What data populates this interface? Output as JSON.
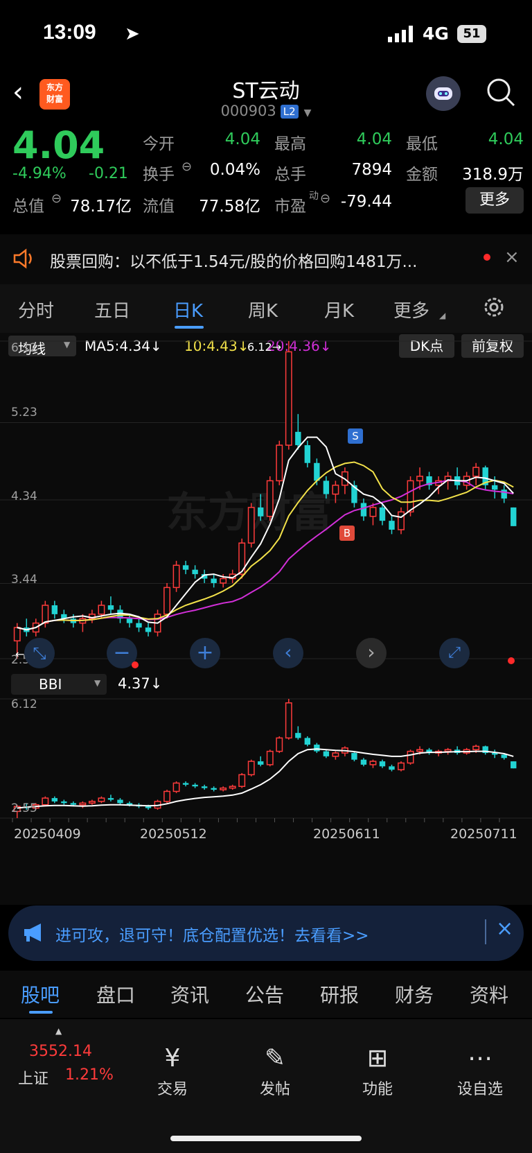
{
  "status": {
    "time": "13:09",
    "network": "4G",
    "battery": "51"
  },
  "header": {
    "logo_text_1": "东方",
    "logo_text_2": "财富",
    "title": "ST云动",
    "code": "000903",
    "badge": "L2"
  },
  "quote": {
    "price": "4.04",
    "change_pct": "-4.94%",
    "change": "-0.21",
    "rows": [
      [
        {
          "l": "今开",
          "v": "4.04",
          "c": "green"
        },
        {
          "l": "最高",
          "v": "4.04",
          "c": "green"
        },
        {
          "l": "最低",
          "v": "4.04",
          "c": "green"
        }
      ],
      [
        {
          "l": "换手",
          "v": "0.04%",
          "c": "white"
        },
        {
          "l": "总手",
          "v": "7894",
          "c": "white"
        },
        {
          "l": "金额",
          "v": "318.9万",
          "c": "white"
        }
      ]
    ],
    "total_value_label": "总值",
    "total_value": "78.17亿",
    "float_label": "流值",
    "float_value": "77.58亿",
    "pe_label": "市盈",
    "pe_sup": "动",
    "pe_value": "-79.44",
    "more": "更多"
  },
  "notice": {
    "text": "股票回购：以不低于1.54元/股的价格回购1481万..."
  },
  "tabs": [
    "分时",
    "五日",
    "日K",
    "周K",
    "月K",
    "更多"
  ],
  "active_tab": "日K",
  "indicator": {
    "ma_select": "均线",
    "ma5": "MA5:4.34↓",
    "ma10": "10:4.43↓",
    "ma20": "20:4.36↓",
    "dk": "DK点",
    "fq": "前复权"
  },
  "axis": {
    "y_top": "6.12",
    "y1": "5.23",
    "y2": "4.34",
    "y3": "3.44",
    "y_bottom": "2.55",
    "high_mark": "6.12→",
    "low_mark": "←2.55"
  },
  "signals": {
    "s": "S",
    "b": "B"
  },
  "sub": {
    "select": "BBI",
    "value": "4.37↓",
    "y_top": "6.12",
    "y_bottom": "2.55"
  },
  "dates": [
    "20250409",
    "20250512",
    "20250611",
    "20250711"
  ],
  "colors": {
    "up": "#ff3b3b",
    "down": "#22d3d3",
    "ma5": "#ffffff",
    "ma10": "#f3e24a",
    "ma20": "#d22fd8"
  },
  "chart_data": {
    "type": "candlestick",
    "y_range": [
      2.55,
      6.12
    ],
    "ohlc": [
      [
        2.75,
        2.95,
        2.55,
        2.9
      ],
      [
        2.9,
        3.0,
        2.8,
        2.85
      ],
      [
        2.85,
        3.0,
        2.8,
        2.95
      ],
      [
        2.95,
        3.2,
        2.9,
        3.15
      ],
      [
        3.15,
        3.2,
        3.0,
        3.05
      ],
      [
        3.05,
        3.1,
        2.95,
        3.0
      ],
      [
        3.0,
        3.05,
        2.9,
        2.95
      ],
      [
        2.95,
        3.05,
        2.85,
        3.0
      ],
      [
        3.0,
        3.1,
        2.95,
        3.05
      ],
      [
        3.05,
        3.2,
        3.0,
        3.15
      ],
      [
        3.15,
        3.25,
        3.05,
        3.1
      ],
      [
        3.1,
        3.15,
        2.95,
        3.0
      ],
      [
        3.0,
        3.05,
        2.9,
        2.95
      ],
      [
        2.95,
        3.0,
        2.85,
        2.9
      ],
      [
        2.9,
        2.95,
        2.8,
        2.85
      ],
      [
        2.85,
        3.1,
        2.8,
        3.05
      ],
      [
        3.05,
        3.4,
        3.0,
        3.35
      ],
      [
        3.35,
        3.65,
        3.3,
        3.6
      ],
      [
        3.6,
        3.65,
        3.5,
        3.55
      ],
      [
        3.55,
        3.6,
        3.45,
        3.5
      ],
      [
        3.5,
        3.55,
        3.4,
        3.45
      ],
      [
        3.45,
        3.5,
        3.35,
        3.4
      ],
      [
        3.4,
        3.5,
        3.35,
        3.45
      ],
      [
        3.45,
        3.55,
        3.4,
        3.5
      ],
      [
        3.5,
        3.9,
        3.45,
        3.85
      ],
      [
        3.85,
        4.3,
        3.8,
        4.25
      ],
      [
        4.25,
        4.4,
        4.1,
        4.15
      ],
      [
        4.15,
        4.6,
        4.1,
        4.55
      ],
      [
        4.55,
        5.0,
        4.5,
        4.95
      ],
      [
        4.95,
        6.12,
        4.9,
        6.0
      ],
      [
        5.1,
        5.3,
        4.9,
        4.95
      ],
      [
        4.95,
        5.0,
        4.7,
        4.75
      ],
      [
        4.75,
        4.8,
        4.5,
        4.55
      ],
      [
        4.55,
        4.6,
        4.35,
        4.4
      ],
      [
        4.4,
        4.55,
        4.3,
        4.5
      ],
      [
        4.5,
        4.7,
        4.4,
        4.65
      ],
      [
        4.5,
        4.55,
        4.25,
        4.3
      ],
      [
        4.3,
        4.35,
        4.1,
        4.15
      ],
      [
        4.15,
        4.3,
        4.05,
        4.25
      ],
      [
        4.25,
        4.3,
        4.05,
        4.1
      ],
      [
        4.1,
        4.15,
        3.95,
        4.0
      ],
      [
        4.0,
        4.25,
        3.95,
        4.2
      ],
      [
        4.2,
        4.6,
        4.15,
        4.55
      ],
      [
        4.55,
        4.7,
        4.45,
        4.6
      ],
      [
        4.6,
        4.65,
        4.45,
        4.5
      ],
      [
        4.5,
        4.6,
        4.4,
        4.55
      ],
      [
        4.55,
        4.65,
        4.45,
        4.6
      ],
      [
        4.6,
        4.7,
        4.45,
        4.5
      ],
      [
        4.5,
        4.65,
        4.45,
        4.6
      ],
      [
        4.6,
        4.75,
        4.5,
        4.7
      ],
      [
        4.7,
        4.72,
        4.45,
        4.5
      ],
      [
        4.5,
        4.6,
        4.35,
        4.45
      ],
      [
        4.45,
        4.5,
        4.3,
        4.35
      ],
      [
        4.25,
        4.25,
        4.04,
        4.04
      ]
    ],
    "bbi": [
      2.85,
      2.88,
      2.9,
      2.92,
      2.93,
      2.93,
      2.92,
      2.91,
      2.92,
      2.94,
      2.95,
      2.95,
      2.94,
      2.93,
      2.92,
      2.93,
      2.98,
      3.05,
      3.1,
      3.14,
      3.17,
      3.19,
      3.21,
      3.24,
      3.3,
      3.42,
      3.55,
      3.72,
      3.95,
      4.25,
      4.48,
      4.6,
      4.62,
      4.6,
      4.58,
      4.57,
      4.54,
      4.5,
      4.46,
      4.43,
      4.4,
      4.4,
      4.44,
      4.5,
      4.52,
      4.52,
      4.53,
      4.54,
      4.54,
      4.55,
      4.55,
      4.52,
      4.48,
      4.4
    ]
  },
  "ad": {
    "text": "进可攻，退可守！底仓配置优选！去看看>>"
  },
  "btabs": [
    "股吧",
    "盘口",
    "资讯",
    "公告",
    "研报",
    "财务",
    "资料"
  ],
  "index": {
    "value": "3552.14",
    "name": "上证",
    "pct": "1.21%"
  },
  "nav": [
    {
      "label": "交易",
      "icon": "¥"
    },
    {
      "label": "发帖",
      "icon": "✎"
    },
    {
      "label": "功能",
      "icon": "⊞"
    },
    {
      "label": "设自选",
      "icon": "⋯"
    }
  ]
}
